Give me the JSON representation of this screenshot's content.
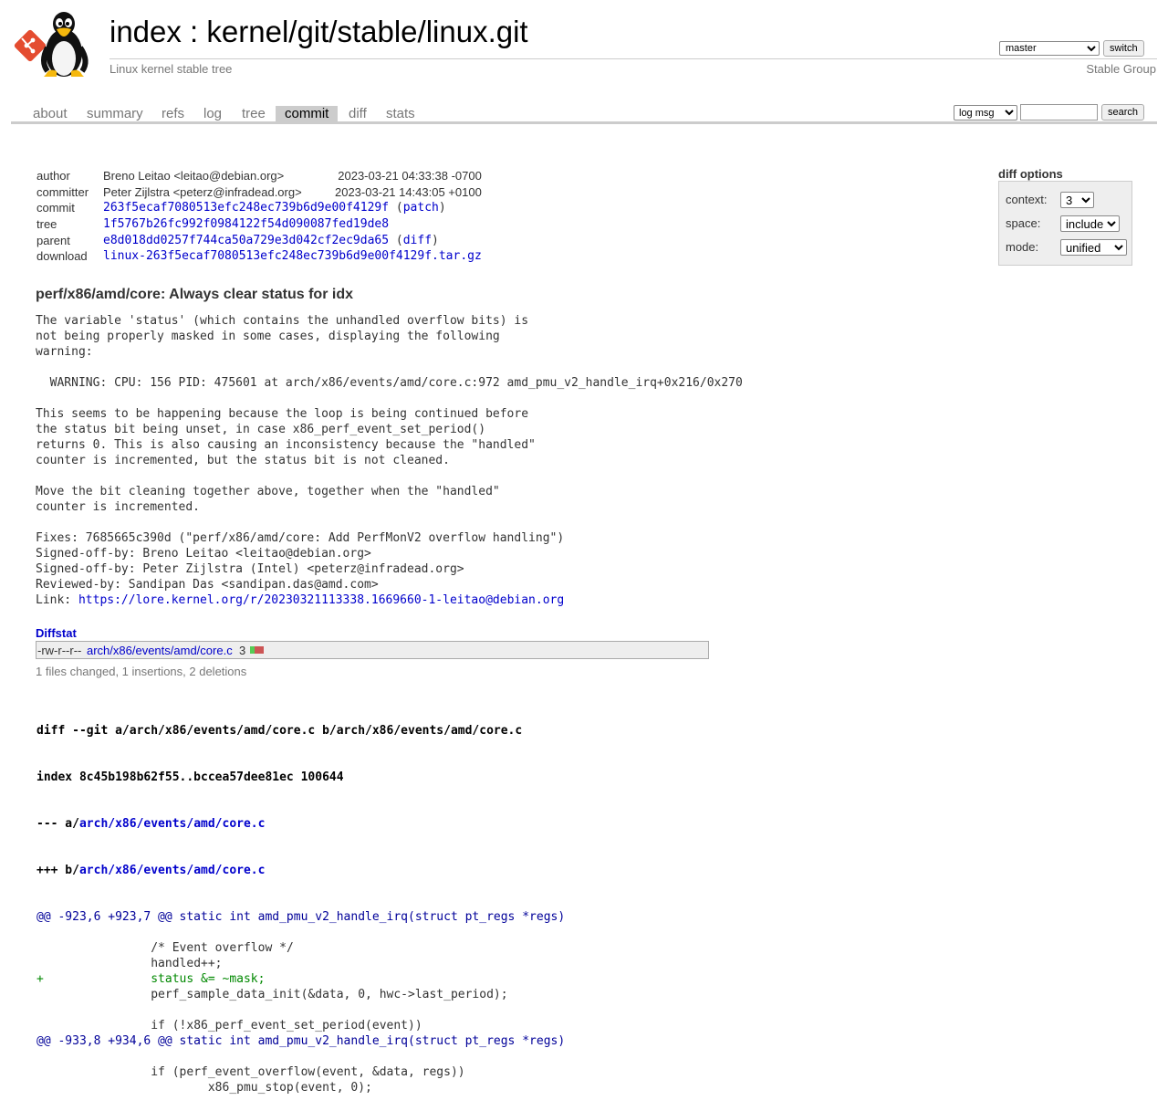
{
  "header": {
    "title": "index : kernel/git/stable/linux.git",
    "subtitle": "Linux kernel stable tree",
    "branch": "master",
    "switch_label": "switch",
    "owner": "Stable Group"
  },
  "tabs": [
    {
      "label": "about"
    },
    {
      "label": "summary"
    },
    {
      "label": "refs"
    },
    {
      "label": "log"
    },
    {
      "label": "tree"
    },
    {
      "label": "commit",
      "active": true
    },
    {
      "label": "diff"
    },
    {
      "label": "stats"
    }
  ],
  "search": {
    "type": "log msg",
    "placeholder": "",
    "button_label": "search"
  },
  "commit_info": {
    "author_label": "author",
    "author": "Breno Leitao <leitao@debian.org>",
    "author_date": "2023-03-21 04:33:38 -0700",
    "committer_label": "committer",
    "committer": "Peter Zijlstra <peterz@infradead.org>",
    "committer_date": "2023-03-21 14:43:05 +0100",
    "commit_label": "commit",
    "commit": "263f5ecaf7080513efc248ec739b6d9e00f4129f",
    "commit_link": "patch",
    "tree_label": "tree",
    "tree": "1f5767b26fc992f0984122f54d090087fed19de8",
    "parent_label": "parent",
    "parent": "e8d018dd0257f744ca50a729e3d042cf2ec9da65",
    "parent_link": "diff",
    "download_label": "download",
    "download": "linux-263f5ecaf7080513efc248ec739b6d9e00f4129f.tar.gz"
  },
  "diff_options": {
    "title": "diff options",
    "context_label": "context:",
    "context": "3",
    "space_label": "space:",
    "space": "include",
    "mode_label": "mode:",
    "mode": "unified"
  },
  "subject": "perf/x86/amd/core: Always clear status for idx",
  "message": "The variable 'status' (which contains the unhandled overflow bits) is\nnot being properly masked in some cases, displaying the following\nwarning:\n\n  WARNING: CPU: 156 PID: 475601 at arch/x86/events/amd/core.c:972 amd_pmu_v2_handle_irq+0x216/0x270\n\nThis seems to be happening because the loop is being continued before\nthe status bit being unset, in case x86_perf_event_set_period()\nreturns 0. This is also causing an inconsistency because the \"handled\"\ncounter is incremented, but the status bit is not cleaned.\n\nMove the bit cleaning together above, together when the \"handled\"\ncounter is incremented.\n\nFixes: 7685665c390d (\"perf/x86/amd/core: Add PerfMonV2 overflow handling\")\nSigned-off-by: Breno Leitao <leitao@debian.org>\nSigned-off-by: Peter Zijlstra (Intel) <peterz@infradead.org>\nReviewed-by: Sandipan Das <sandipan.das@amd.com>\nLink: ",
  "message_link": "https://lore.kernel.org/r/20230321113338.1669660-1-leitao@debian.org",
  "diffstat": {
    "title": "Diffstat",
    "mode": "-rw-r--r--",
    "file": "arch/x86/events/amd/core.c",
    "changes": "3",
    "insertions_count": 1,
    "deletions_count": 2,
    "summary": "1 files changed, 1 insertions, 2 deletions"
  },
  "diff": {
    "git_line": "diff --git a/arch/x86/events/amd/core.c b/arch/x86/events/amd/core.c",
    "index_line": "index 8c45b198b62f55..bccea57dee81ec 100644",
    "minus_prefix": "--- a/",
    "plus_prefix": "+++ b/",
    "file": "arch/x86/events/amd/core.c",
    "lines": [
      {
        "type": "hunk",
        "text": "@@ -923,6 +923,7 @@ static int amd_pmu_v2_handle_irq(struct pt_regs *regs)"
      },
      {
        "type": "ctx",
        "text": " "
      },
      {
        "type": "ctx",
        "text": " \t\t/* Event overflow */"
      },
      {
        "type": "ctx",
        "text": " \t\thandled++;"
      },
      {
        "type": "add",
        "text": "+\t\tstatus &= ~mask;"
      },
      {
        "type": "ctx",
        "text": " \t\tperf_sample_data_init(&data, 0, hwc->last_period);"
      },
      {
        "type": "ctx",
        "text": " "
      },
      {
        "type": "ctx",
        "text": " \t\tif (!x86_perf_event_set_period(event))"
      },
      {
        "type": "hunk",
        "text": "@@ -933,8 +934,6 @@ static int amd_pmu_v2_handle_irq(struct pt_regs *regs)"
      },
      {
        "type": "ctx",
        "text": " "
      },
      {
        "type": "ctx",
        "text": " \t\tif (perf_event_overflow(event, &data, regs))"
      },
      {
        "type": "ctx",
        "text": " \t\t\tx86_pmu_stop(event, 0);"
      }
    ]
  }
}
